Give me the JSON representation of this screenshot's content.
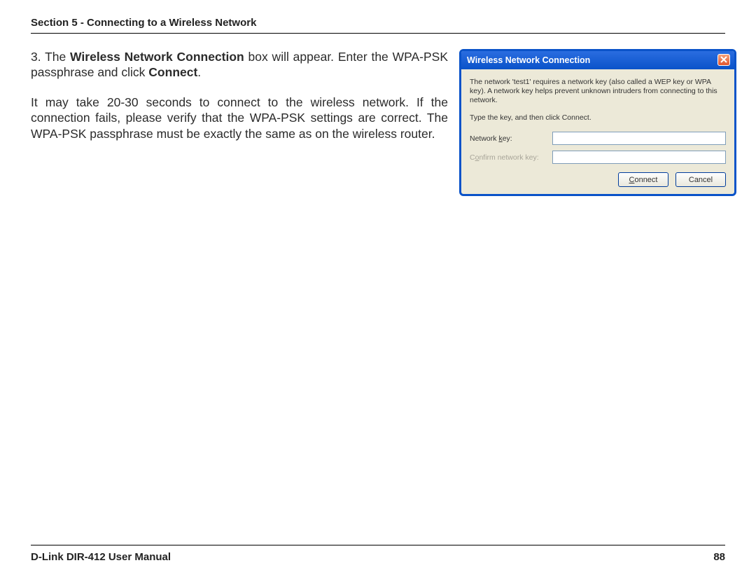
{
  "header": {
    "section_label": "Section 5 - Connecting to a Wireless Network"
  },
  "body": {
    "step_number": "3.",
    "step_text_1": "The ",
    "step_bold_1": "Wireless Network Connection",
    "step_text_2": " box will appear. Enter the WPA-PSK passphrase and click ",
    "step_bold_2": "Connect",
    "step_text_3": ".",
    "para2": "It may take 20-30 seconds to connect to the wireless network. If the connection fails, please verify that the WPA-PSK settings are correct. The WPA-PSK passphrase must be exactly the same as on the wireless router."
  },
  "dialog": {
    "title": "Wireless Network Connection",
    "description": "The network 'test1' requires a network key (also called a WEP key or WPA key). A network key helps prevent unknown intruders from connecting to this network.",
    "instruction": "Type the key, and then click Connect.",
    "label_network_key_pre": "Network ",
    "label_network_key_ul": "k",
    "label_network_key_post": "ey:",
    "label_confirm_pre": "C",
    "label_confirm_ul": "o",
    "label_confirm_post": "nfirm network key:",
    "network_key_value": "",
    "confirm_key_value": "",
    "btn_connect_ul": "C",
    "btn_connect_rest": "onnect",
    "btn_cancel": "Cancel"
  },
  "footer": {
    "manual": "D-Link DIR-412 User Manual",
    "page": "88"
  }
}
